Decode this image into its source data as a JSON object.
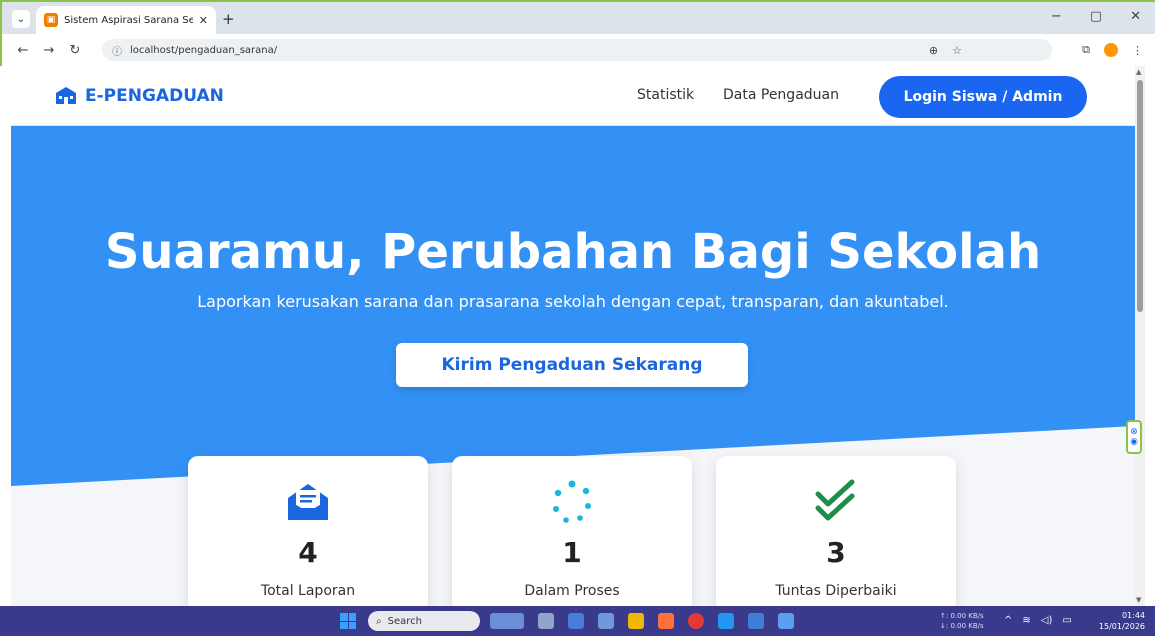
{
  "browser": {
    "tab_title": "Sistem Aspirasi Sarana Sekolah",
    "url": "localhost/pengaduan_sarana/",
    "controls": {
      "minimize": "−",
      "restore": "▢",
      "close": "✕"
    }
  },
  "nav": {
    "brand": "E-PENGADUAN",
    "links": [
      "Statistik",
      "Data Pengaduan"
    ],
    "login": "Login Siswa / Admin"
  },
  "hero": {
    "title": "Suaramu, Perubahan Bagi Sekolah",
    "subtitle": "Laporkan kerusakan sarana dan prasarana sekolah dengan cepat, transparan, dan akuntabel.",
    "cta": "Kirim Pengaduan Sekarang"
  },
  "stats": [
    {
      "value": "4",
      "label": "Total Laporan",
      "icon": "envelope-icon",
      "color": "#1a66e0"
    },
    {
      "value": "1",
      "label": "Dalam Proses",
      "icon": "spinner-icon",
      "color": "#17b8d9"
    },
    {
      "value": "3",
      "label": "Tuntas Diperbaiki",
      "icon": "double-check-icon",
      "color": "#1e8e4e"
    }
  ],
  "taskbar": {
    "search": "Search",
    "net_up": "↑: 0.00 KB/s",
    "net_down": "↓: 0.00 KB/s",
    "time": "01:44",
    "date": "15/01/2026"
  },
  "colors": {
    "primary": "#1a66f0",
    "hero_bg": "#3391f5"
  }
}
